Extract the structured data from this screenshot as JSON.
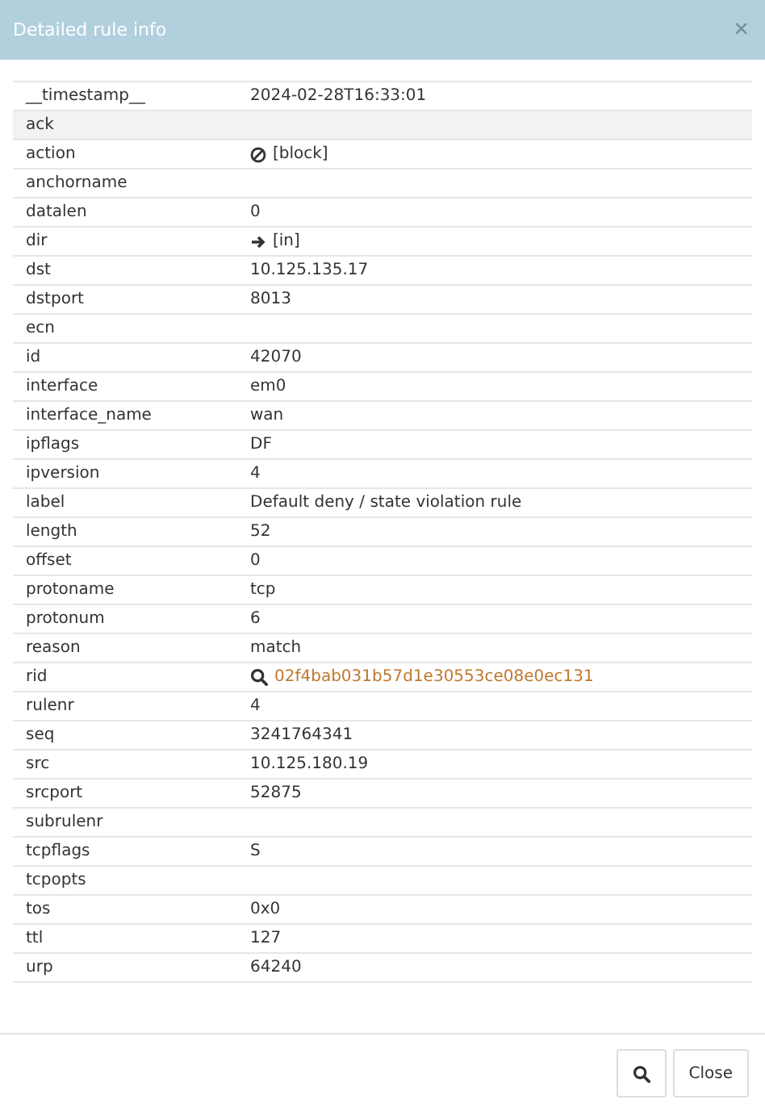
{
  "dialog": {
    "title": "Detailed rule info",
    "close": "×"
  },
  "rows": [
    {
      "field": "__timestamp__",
      "value": "2024-02-28T16:33:01",
      "kind": "text",
      "highlighted": false
    },
    {
      "field": "ack",
      "value": "",
      "kind": "text",
      "highlighted": true
    },
    {
      "field": "action",
      "value": "[block]",
      "kind": "block",
      "highlighted": false
    },
    {
      "field": "anchorname",
      "value": "",
      "kind": "text",
      "highlighted": false
    },
    {
      "field": "datalen",
      "value": "0",
      "kind": "text",
      "highlighted": false
    },
    {
      "field": "dir",
      "value": "[in]",
      "kind": "direction",
      "highlighted": false
    },
    {
      "field": "dst",
      "value": "10.125.135.17",
      "kind": "text",
      "highlighted": false
    },
    {
      "field": "dstport",
      "value": "8013",
      "kind": "text",
      "highlighted": false
    },
    {
      "field": "ecn",
      "value": "",
      "kind": "text",
      "highlighted": false
    },
    {
      "field": "id",
      "value": "42070",
      "kind": "text",
      "highlighted": false
    },
    {
      "field": "interface",
      "value": "em0",
      "kind": "text",
      "highlighted": false
    },
    {
      "field": "interface_name",
      "value": "wan",
      "kind": "text",
      "highlighted": false
    },
    {
      "field": "ipflags",
      "value": "DF",
      "kind": "text",
      "highlighted": false
    },
    {
      "field": "ipversion",
      "value": "4",
      "kind": "text",
      "highlighted": false
    },
    {
      "field": "label",
      "value": "Default deny / state violation rule",
      "kind": "text",
      "highlighted": false
    },
    {
      "field": "length",
      "value": "52",
      "kind": "text",
      "highlighted": false
    },
    {
      "field": "offset",
      "value": "0",
      "kind": "text",
      "highlighted": false
    },
    {
      "field": "protoname",
      "value": "tcp",
      "kind": "text",
      "highlighted": false
    },
    {
      "field": "protonum",
      "value": "6",
      "kind": "text",
      "highlighted": false
    },
    {
      "field": "reason",
      "value": "match",
      "kind": "text",
      "highlighted": false
    },
    {
      "field": "rid",
      "value": "02f4bab031b57d1e30553ce08e0ec131",
      "kind": "link",
      "highlighted": false
    },
    {
      "field": "rulenr",
      "value": "4",
      "kind": "text",
      "highlighted": false
    },
    {
      "field": "seq",
      "value": "3241764341",
      "kind": "text",
      "highlighted": false
    },
    {
      "field": "src",
      "value": "10.125.180.19",
      "kind": "text",
      "highlighted": false
    },
    {
      "field": "srcport",
      "value": "52875",
      "kind": "text",
      "highlighted": false
    },
    {
      "field": "subrulenr",
      "value": "",
      "kind": "text",
      "highlighted": false
    },
    {
      "field": "tcpflags",
      "value": "S",
      "kind": "text",
      "highlighted": false
    },
    {
      "field": "tcpopts",
      "value": "",
      "kind": "text",
      "highlighted": false
    },
    {
      "field": "tos",
      "value": "0x0",
      "kind": "text",
      "highlighted": false
    },
    {
      "field": "ttl",
      "value": "127",
      "kind": "text",
      "highlighted": false
    },
    {
      "field": "urp",
      "value": "64240",
      "kind": "text",
      "highlighted": false
    }
  ],
  "footer": {
    "close_button": "Close"
  }
}
